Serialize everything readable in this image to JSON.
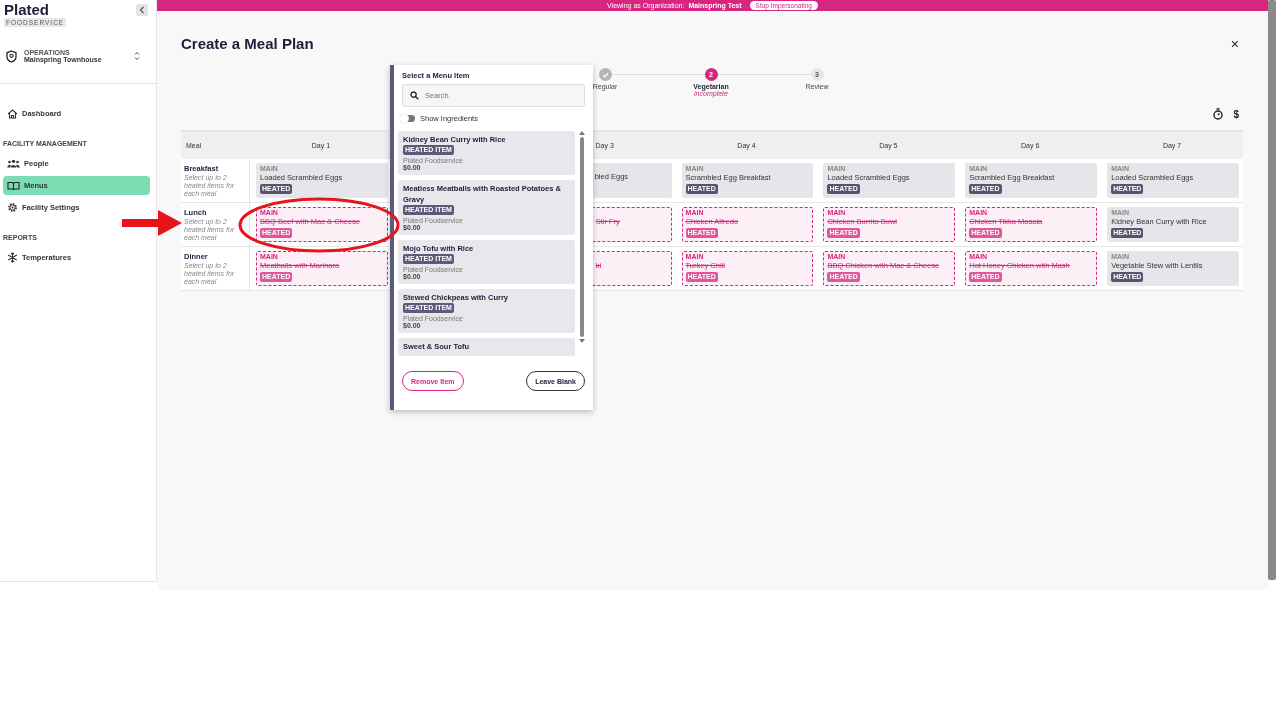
{
  "banner": {
    "text": "Viewing as Organization:",
    "organization": "Mainspring Test",
    "button": "Stop Impersonating"
  },
  "sidebar": {
    "logo": {
      "name": "Plated",
      "tagline": "FOODSERVICE"
    },
    "org": {
      "label": "OPERATIONS",
      "name": "Mainspring Townhouse"
    },
    "sections": [
      {
        "items": [
          {
            "label": "Dashboard",
            "selected": false
          }
        ]
      },
      {
        "title": "FACILITY MANAGEMENT",
        "items": [
          {
            "label": "People",
            "selected": false
          },
          {
            "label": "Menus",
            "selected": true
          },
          {
            "label": "Facility Settings",
            "selected": false
          }
        ]
      },
      {
        "title": "REPORTS",
        "items": [
          {
            "label": "Temperatures",
            "selected": false
          }
        ]
      }
    ]
  },
  "page": {
    "title": "Create a Meal Plan",
    "close": "×",
    "dollar": "$"
  },
  "stepper": [
    {
      "label": "Regular",
      "done": true,
      "selected": false
    },
    {
      "number": "2",
      "label": "Vegetarian",
      "sublabel": "incomplete",
      "done": false,
      "selected": true
    },
    {
      "number": "3",
      "label": "Review",
      "done": false,
      "selected": false
    }
  ],
  "table": {
    "meal_header": "Meal",
    "days": [
      {
        "label": "Day 1"
      },
      {
        "label": "Day 3"
      },
      {
        "label": "Day 4"
      },
      {
        "label": "Day 5"
      },
      {
        "label": "Day 6"
      },
      {
        "label": "Day 7"
      }
    ],
    "rows": [
      {
        "meal": "Breakfast",
        "hint": "Select up to 2 heated items for each meal",
        "cells": [
          {
            "kind": "full",
            "category": "MAIN",
            "name": "Loaded Scrambled Eggs",
            "badge": "HEATED",
            "removed": false
          },
          null,
          {
            "kind": "partial",
            "name": "bled Eggs",
            "removed": false
          },
          {
            "kind": "full",
            "category": "MAIN",
            "name": "Scrambled Egg Breakfast",
            "badge": "HEATED",
            "removed": false
          },
          {
            "kind": "full",
            "category": "MAIN",
            "name": "Loaded Scrambled Eggs",
            "badge": "HEATED",
            "removed": false
          },
          {
            "kind": "full",
            "category": "MAIN",
            "name": "Scrambled Egg Breakfast",
            "badge": "HEATED",
            "removed": false
          },
          {
            "kind": "full",
            "category": "MAIN",
            "name": "Loaded Scrambled Eggs",
            "badge": "HEATED",
            "removed": false
          }
        ]
      },
      {
        "meal": "Lunch",
        "hint": "Select up to 2 heated items for each meal",
        "cells": [
          {
            "kind": "full",
            "category": "MAIN",
            "name": "BBQ Beef with Mac & Cheese",
            "badge": "HEATED",
            "removed": true
          },
          null,
          {
            "kind": "partial",
            "name": "Stir Fry",
            "removed": true
          },
          {
            "kind": "full",
            "category": "MAIN",
            "name": "Chicken Alfredo",
            "badge": "HEATED",
            "removed": true
          },
          {
            "kind": "full",
            "category": "MAIN",
            "name": "Chicken Burrito Bowl",
            "badge": "HEATED",
            "removed": true
          },
          {
            "kind": "full",
            "category": "MAIN",
            "name": "Chicken Tikka Masala",
            "badge": "HEATED",
            "removed": true
          },
          {
            "kind": "full",
            "category": "MAIN",
            "name": "Kidney Bean Curry with Rice",
            "badge": "HEATED",
            "removed": false
          }
        ]
      },
      {
        "meal": "Dinner",
        "hint": "Select up to 2 heated items for each meal",
        "cells": [
          {
            "kind": "full",
            "category": "MAIN",
            "name": "Meatballs with Marinara",
            "badge": "HEATED",
            "removed": true
          },
          null,
          {
            "kind": "partial",
            "name": "ki",
            "removed": true
          },
          {
            "kind": "full",
            "category": "MAIN",
            "name": "Turkey Chili",
            "badge": "HEATED",
            "removed": true
          },
          {
            "kind": "full",
            "category": "MAIN",
            "name": "BBQ Chicken with Mac & Cheese",
            "badge": "HEATED",
            "removed": true
          },
          {
            "kind": "full",
            "category": "MAIN",
            "name": "Hot Honey Chicken with Mash",
            "badge": "HEATED",
            "removed": true
          },
          {
            "kind": "full",
            "category": "MAIN",
            "name": "Vegetable Stew with Lentils",
            "badge": "HEATED",
            "removed": false
          }
        ]
      }
    ]
  },
  "picker": {
    "title": "Select a Menu Item",
    "search": {
      "placeholder": "Search"
    },
    "toggle": {
      "label": "Show Ingredients",
      "on": false
    },
    "items": [
      {
        "name": "Kidney Bean Curry with Rice",
        "badge": "HEATED ITEM",
        "vendor": "Plated Foodservice",
        "price": "$0.00"
      },
      {
        "name": "Meatless Meatballs with Roasted Potatoes & Gravy",
        "badge": "HEATED ITEM",
        "vendor": "Plated Foodservice",
        "price": "$0.00"
      },
      {
        "name": "Mojo Tofu with Rice",
        "badge": "HEATED ITEM",
        "vendor": "Plated Foodservice",
        "price": "$0.00"
      },
      {
        "name": "Stewed Chickpeas with Curry",
        "badge": "HEATED ITEM",
        "vendor": "Plated Foodservice",
        "price": "$0.00"
      },
      {
        "name": "Sweet & Sour Tofu"
      }
    ],
    "buttons": [
      {
        "label": "Remove Item",
        "kind": "danger"
      },
      {
        "label": "Leave Blank",
        "kind": "neutral"
      }
    ]
  }
}
